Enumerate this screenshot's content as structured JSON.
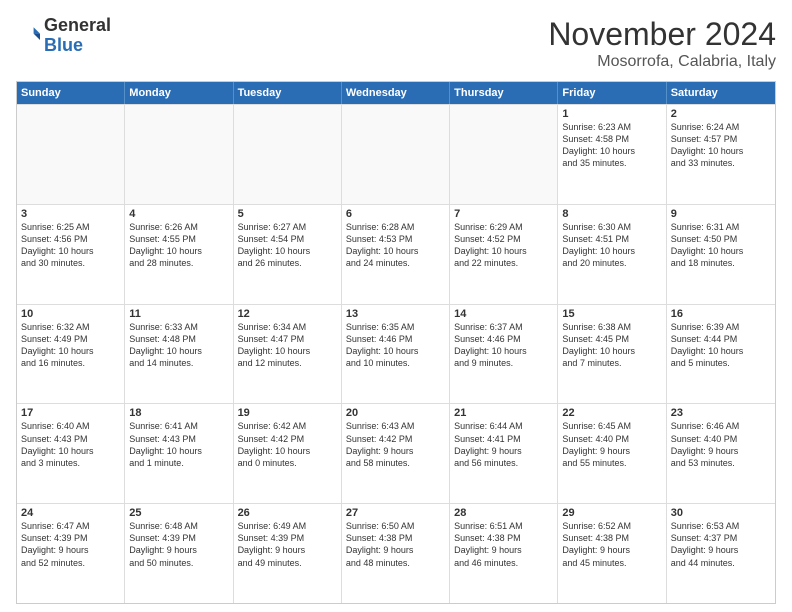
{
  "logo": {
    "general": "General",
    "blue": "Blue"
  },
  "title": "November 2024",
  "location": "Mosorrofa, Calabria, Italy",
  "days_header": [
    "Sunday",
    "Monday",
    "Tuesday",
    "Wednesday",
    "Thursday",
    "Friday",
    "Saturday"
  ],
  "rows": [
    [
      {
        "day": "",
        "text": ""
      },
      {
        "day": "",
        "text": ""
      },
      {
        "day": "",
        "text": ""
      },
      {
        "day": "",
        "text": ""
      },
      {
        "day": "",
        "text": ""
      },
      {
        "day": "1",
        "text": "Sunrise: 6:23 AM\nSunset: 4:58 PM\nDaylight: 10 hours\nand 35 minutes."
      },
      {
        "day": "2",
        "text": "Sunrise: 6:24 AM\nSunset: 4:57 PM\nDaylight: 10 hours\nand 33 minutes."
      }
    ],
    [
      {
        "day": "3",
        "text": "Sunrise: 6:25 AM\nSunset: 4:56 PM\nDaylight: 10 hours\nand 30 minutes."
      },
      {
        "day": "4",
        "text": "Sunrise: 6:26 AM\nSunset: 4:55 PM\nDaylight: 10 hours\nand 28 minutes."
      },
      {
        "day": "5",
        "text": "Sunrise: 6:27 AM\nSunset: 4:54 PM\nDaylight: 10 hours\nand 26 minutes."
      },
      {
        "day": "6",
        "text": "Sunrise: 6:28 AM\nSunset: 4:53 PM\nDaylight: 10 hours\nand 24 minutes."
      },
      {
        "day": "7",
        "text": "Sunrise: 6:29 AM\nSunset: 4:52 PM\nDaylight: 10 hours\nand 22 minutes."
      },
      {
        "day": "8",
        "text": "Sunrise: 6:30 AM\nSunset: 4:51 PM\nDaylight: 10 hours\nand 20 minutes."
      },
      {
        "day": "9",
        "text": "Sunrise: 6:31 AM\nSunset: 4:50 PM\nDaylight: 10 hours\nand 18 minutes."
      }
    ],
    [
      {
        "day": "10",
        "text": "Sunrise: 6:32 AM\nSunset: 4:49 PM\nDaylight: 10 hours\nand 16 minutes."
      },
      {
        "day": "11",
        "text": "Sunrise: 6:33 AM\nSunset: 4:48 PM\nDaylight: 10 hours\nand 14 minutes."
      },
      {
        "day": "12",
        "text": "Sunrise: 6:34 AM\nSunset: 4:47 PM\nDaylight: 10 hours\nand 12 minutes."
      },
      {
        "day": "13",
        "text": "Sunrise: 6:35 AM\nSunset: 4:46 PM\nDaylight: 10 hours\nand 10 minutes."
      },
      {
        "day": "14",
        "text": "Sunrise: 6:37 AM\nSunset: 4:46 PM\nDaylight: 10 hours\nand 9 minutes."
      },
      {
        "day": "15",
        "text": "Sunrise: 6:38 AM\nSunset: 4:45 PM\nDaylight: 10 hours\nand 7 minutes."
      },
      {
        "day": "16",
        "text": "Sunrise: 6:39 AM\nSunset: 4:44 PM\nDaylight: 10 hours\nand 5 minutes."
      }
    ],
    [
      {
        "day": "17",
        "text": "Sunrise: 6:40 AM\nSunset: 4:43 PM\nDaylight: 10 hours\nand 3 minutes."
      },
      {
        "day": "18",
        "text": "Sunrise: 6:41 AM\nSunset: 4:43 PM\nDaylight: 10 hours\nand 1 minute."
      },
      {
        "day": "19",
        "text": "Sunrise: 6:42 AM\nSunset: 4:42 PM\nDaylight: 10 hours\nand 0 minutes."
      },
      {
        "day": "20",
        "text": "Sunrise: 6:43 AM\nSunset: 4:42 PM\nDaylight: 9 hours\nand 58 minutes."
      },
      {
        "day": "21",
        "text": "Sunrise: 6:44 AM\nSunset: 4:41 PM\nDaylight: 9 hours\nand 56 minutes."
      },
      {
        "day": "22",
        "text": "Sunrise: 6:45 AM\nSunset: 4:40 PM\nDaylight: 9 hours\nand 55 minutes."
      },
      {
        "day": "23",
        "text": "Sunrise: 6:46 AM\nSunset: 4:40 PM\nDaylight: 9 hours\nand 53 minutes."
      }
    ],
    [
      {
        "day": "24",
        "text": "Sunrise: 6:47 AM\nSunset: 4:39 PM\nDaylight: 9 hours\nand 52 minutes."
      },
      {
        "day": "25",
        "text": "Sunrise: 6:48 AM\nSunset: 4:39 PM\nDaylight: 9 hours\nand 50 minutes."
      },
      {
        "day": "26",
        "text": "Sunrise: 6:49 AM\nSunset: 4:39 PM\nDaylight: 9 hours\nand 49 minutes."
      },
      {
        "day": "27",
        "text": "Sunrise: 6:50 AM\nSunset: 4:38 PM\nDaylight: 9 hours\nand 48 minutes."
      },
      {
        "day": "28",
        "text": "Sunrise: 6:51 AM\nSunset: 4:38 PM\nDaylight: 9 hours\nand 46 minutes."
      },
      {
        "day": "29",
        "text": "Sunrise: 6:52 AM\nSunset: 4:38 PM\nDaylight: 9 hours\nand 45 minutes."
      },
      {
        "day": "30",
        "text": "Sunrise: 6:53 AM\nSunset: 4:37 PM\nDaylight: 9 hours\nand 44 minutes."
      }
    ]
  ]
}
